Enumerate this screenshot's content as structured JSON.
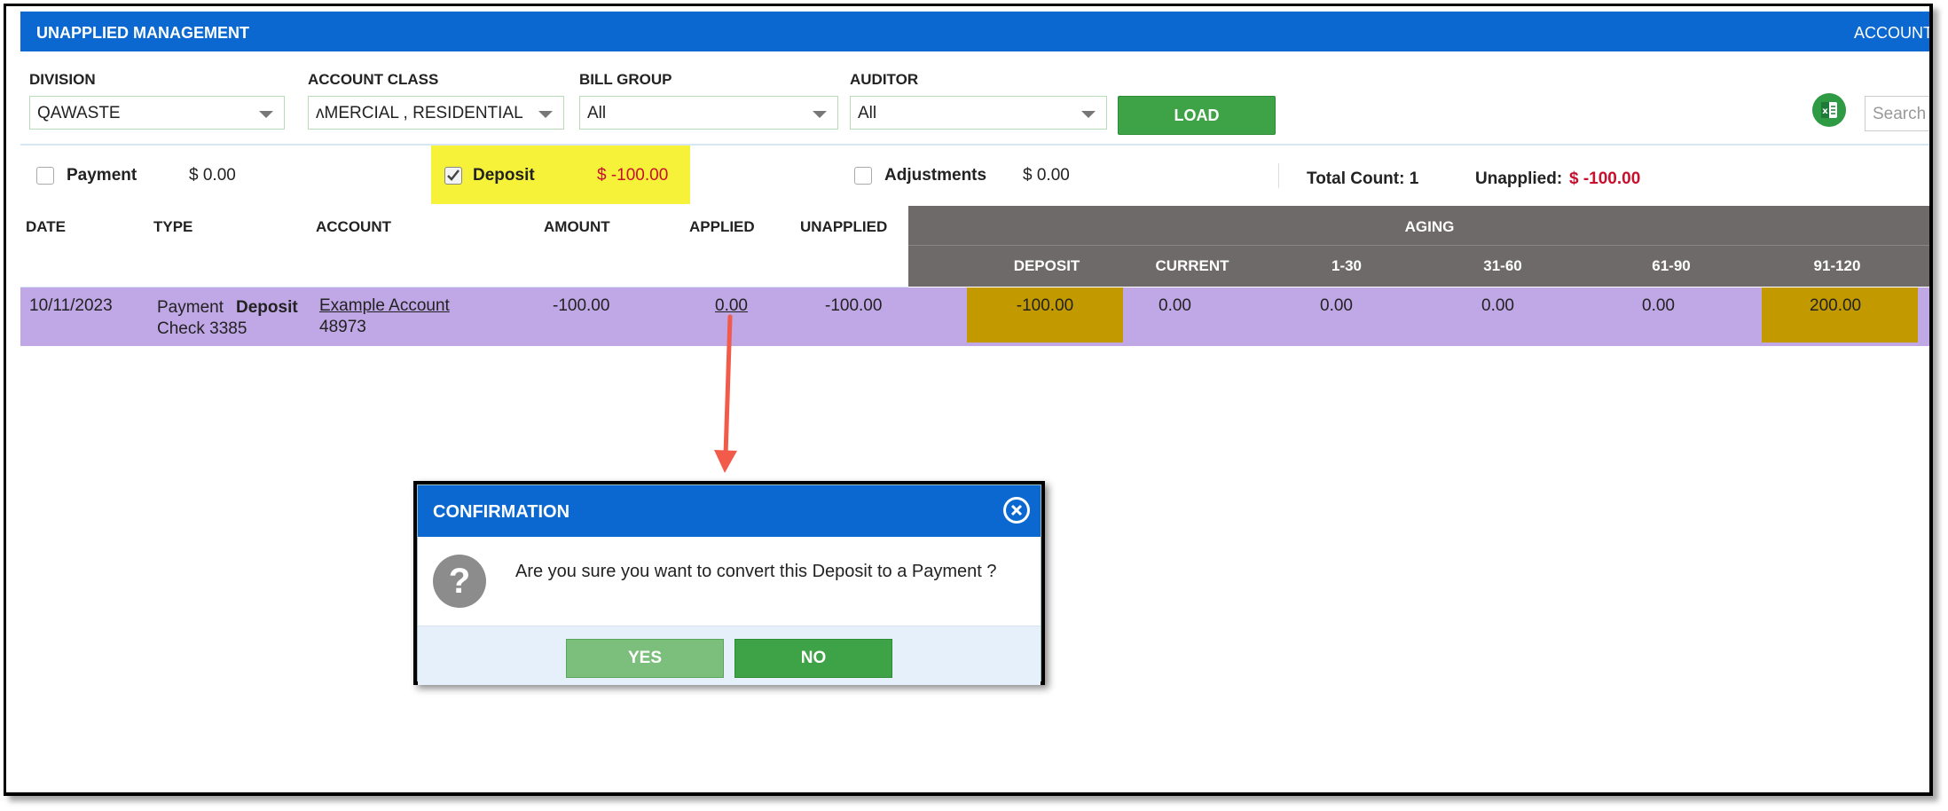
{
  "header": {
    "title": "UNAPPLIED MANAGEMENT",
    "right_label": "ACCOUNT"
  },
  "filters": {
    "division": {
      "label": "DIVISION",
      "value": "QAWASTE"
    },
    "account_class": {
      "label": "ACCOUNT CLASS",
      "value": "ʌMERCIAL , RESIDENTIAL"
    },
    "bill_group": {
      "label": "BILL GROUP",
      "value": "All"
    },
    "auditor": {
      "label": "AUDITOR",
      "value": "All"
    },
    "load_label": "LOAD",
    "search_placeholder": "Search"
  },
  "totals": {
    "payment": {
      "label": "Payment",
      "value": "$ 0.00",
      "checked": false
    },
    "deposit": {
      "label": "Deposit",
      "value": "$ -100.00",
      "checked": true
    },
    "adjustments": {
      "label": "Adjustments",
      "value": "$ 0.00",
      "checked": false
    },
    "total_count": "Total Count: 1",
    "unapplied_label": "Unapplied:",
    "unapplied_value": "$ -100.00"
  },
  "table": {
    "columns": [
      "DATE",
      "TYPE",
      "ACCOUNT",
      "AMOUNT",
      "APPLIED",
      "UNAPPLIED"
    ],
    "aging_label": "AGING",
    "aging_columns": [
      "DEPOSIT",
      "CURRENT",
      "1-30",
      "31-60",
      "61-90",
      "91-120"
    ],
    "row": {
      "date": "10/11/2023",
      "type_prefix": "Payment",
      "type_bold": "Deposit",
      "type_line2": "Check 3385",
      "account_name": "Example Account",
      "account_number": "48973",
      "amount": "-100.00",
      "applied": "0.00",
      "unapplied": "-100.00",
      "aging_values": [
        "-100.00",
        "0.00",
        "0.00",
        "0.00",
        "0.00",
        "200.00"
      ]
    }
  },
  "dialog": {
    "title": "CONFIRMATION",
    "message": "Are you sure you want to convert this Deposit to a Payment ?",
    "yes_label": "YES",
    "no_label": "NO"
  },
  "colors": {
    "brand_blue": "#0a68d0",
    "green": "#3ea246",
    "row_purple": "#c0a7e6",
    "aging_gray": "#6e6a6a",
    "gold": "#c29a00",
    "highlight_yellow": "#f6f23a",
    "negative_red": "#c8102e",
    "arrow": "#f25a4a"
  },
  "icons": [
    "chevron-down-icon",
    "checkbox-icon",
    "excel-icon",
    "close-icon",
    "question-icon",
    "arrow-annotation"
  ]
}
